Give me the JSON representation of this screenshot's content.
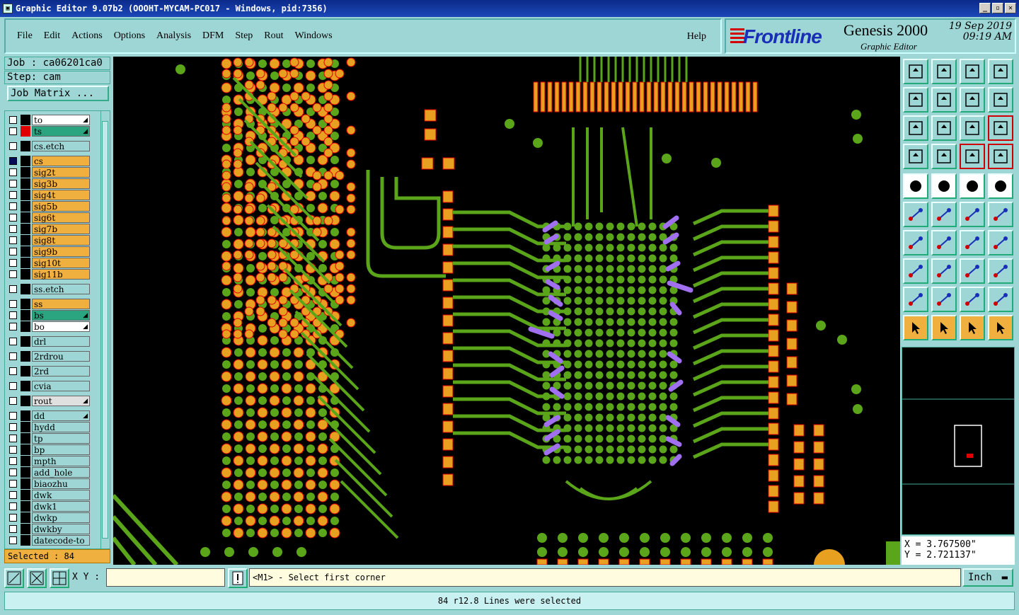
{
  "window": {
    "title": "Graphic Editor 9.07b2 (OOOHT-MYCAM-PC017 - Windows, pid:7356)"
  },
  "menu": [
    "File",
    "Edit",
    "Actions",
    "Options",
    "Analysis",
    "DFM",
    "Step",
    "Rout",
    "Windows"
  ],
  "menu_help": "Help",
  "brand": {
    "logo": "Frontline",
    "product": "Genesis 2000",
    "subtitle": "Graphic Editor",
    "date": "19 Sep 2019",
    "time": "09:19 AM"
  },
  "job": {
    "job_label": "Job : ca06201ca0",
    "step_label": "Step: cam",
    "matrix_button": "Job Matrix ..."
  },
  "layers": [
    {
      "name": "to",
      "bg": "#ffffff",
      "sw": "#000000",
      "arrow": true
    },
    {
      "name": "ts",
      "bg": "#2aa580",
      "sw": "#e00000",
      "arrow": true
    },
    {
      "name": "cs.etch",
      "bg": "#9ed6d6",
      "sw": "#000000"
    },
    {
      "name": "cs",
      "bg": "#f0b040",
      "sw": "#000000",
      "on": true
    },
    {
      "name": "sig2t",
      "bg": "#f0b040",
      "sw": "#000000"
    },
    {
      "name": "sig3b",
      "bg": "#f0b040",
      "sw": "#000000"
    },
    {
      "name": "sig4t",
      "bg": "#f0b040",
      "sw": "#000000"
    },
    {
      "name": "sig5b",
      "bg": "#f0b040",
      "sw": "#000000"
    },
    {
      "name": "sig6t",
      "bg": "#f0b040",
      "sw": "#000000"
    },
    {
      "name": "sig7b",
      "bg": "#f0b040",
      "sw": "#000000"
    },
    {
      "name": "sig8t",
      "bg": "#f0b040",
      "sw": "#000000"
    },
    {
      "name": "sig9b",
      "bg": "#f0b040",
      "sw": "#000000"
    },
    {
      "name": "sig10t",
      "bg": "#f0b040",
      "sw": "#000000"
    },
    {
      "name": "sig11b",
      "bg": "#f0b040",
      "sw": "#000000"
    },
    {
      "name": "ss.etch",
      "bg": "#9ed6d6",
      "sw": "#000000"
    },
    {
      "name": "ss",
      "bg": "#f0b040",
      "sw": "#000000"
    },
    {
      "name": "bs",
      "bg": "#2aa580",
      "sw": "#000000",
      "arrow": true
    },
    {
      "name": "bo",
      "bg": "#ffffff",
      "sw": "#000000",
      "arrow": true
    },
    {
      "name": "drl",
      "bg": "#9ed6d6",
      "sw": "#000000"
    },
    {
      "name": "2rdrou",
      "bg": "#9ed6d6",
      "sw": "#000000"
    },
    {
      "name": "2rd",
      "bg": "#9ed6d6",
      "sw": "#000000"
    },
    {
      "name": "cvia",
      "bg": "#9ed6d6",
      "sw": "#000000"
    },
    {
      "name": "rout",
      "bg": "#e0e0e0",
      "sw": "#000000",
      "arrow": true
    },
    {
      "name": "dd",
      "bg": "#9ed6d6",
      "sw": "#000000",
      "arrow": true
    },
    {
      "name": "hydd",
      "bg": "#9ed6d6",
      "sw": "#000000"
    },
    {
      "name": "tp",
      "bg": "#9ed6d6",
      "sw": "#000000"
    },
    {
      "name": "bp",
      "bg": "#9ed6d6",
      "sw": "#000000"
    },
    {
      "name": "mpth",
      "bg": "#9ed6d6",
      "sw": "#000000"
    },
    {
      "name": "add_hole",
      "bg": "#9ed6d6",
      "sw": "#000000"
    },
    {
      "name": "biaozhu",
      "bg": "#9ed6d6",
      "sw": "#000000"
    },
    {
      "name": "dwk",
      "bg": "#9ed6d6",
      "sw": "#000000"
    },
    {
      "name": "dwk1",
      "bg": "#9ed6d6",
      "sw": "#000000"
    },
    {
      "name": "dwkp",
      "bg": "#9ed6d6",
      "sw": "#000000"
    },
    {
      "name": "dwkby",
      "bg": "#9ed6d6",
      "sw": "#000000"
    },
    {
      "name": "datecode-to",
      "bg": "#9ed6d6",
      "sw": "#000000"
    }
  ],
  "selected_label": "Selected : 84",
  "coords": {
    "x": "X = 3.767500\"",
    "y": "Y = 2.721137\""
  },
  "xy_label": "X Y :",
  "xy_value": "",
  "prompt": "<M1> - Select first corner",
  "units": "Inch",
  "status": "84 r12.8 Lines were selected",
  "colors": {
    "copper": "#5aa51a",
    "pad": "#e8a020",
    "pad_outline": "#e00000",
    "selected": "#a070f0",
    "background": "#000000"
  }
}
